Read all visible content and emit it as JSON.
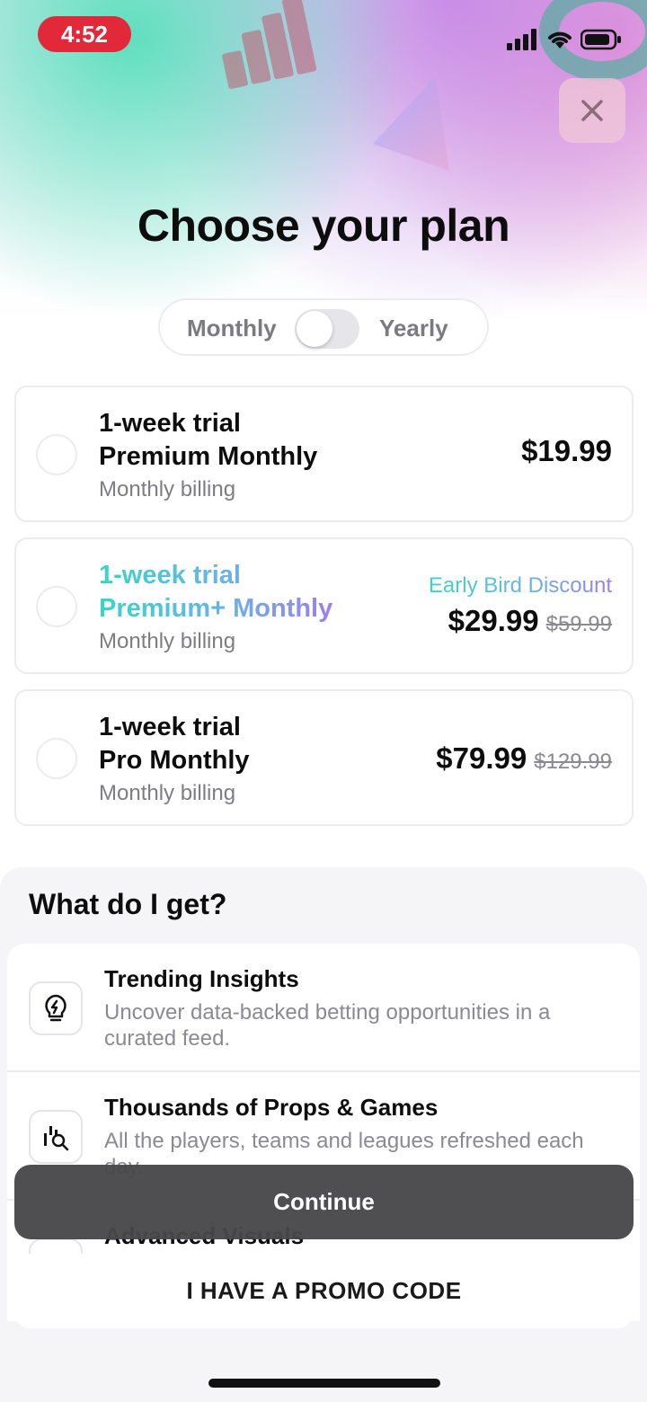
{
  "status_bar": {
    "time": "4:52",
    "icons": [
      "signal-icon",
      "wifi-icon",
      "battery-icon"
    ]
  },
  "header": {
    "title": "Choose your plan",
    "close_icon": "close-icon"
  },
  "billing_toggle": {
    "left_label": "Monthly",
    "right_label": "Yearly",
    "selected": "Monthly"
  },
  "plans": [
    {
      "line1": "1-week trial",
      "line2": "Premium Monthly",
      "billing": "Monthly billing",
      "price": "$19.99",
      "old_price": "",
      "badge": ""
    },
    {
      "line1": "1-week trial",
      "line2": "Premium+ Monthly",
      "billing": "Monthly billing",
      "price": "$29.99",
      "old_price": "$59.99",
      "badge": "Early Bird Discount"
    },
    {
      "line1": "1-week trial",
      "line2": "Pro Monthly",
      "billing": "Monthly billing",
      "price": "$79.99",
      "old_price": "$129.99",
      "badge": ""
    }
  ],
  "benefits": {
    "title": "What do I get?",
    "items": [
      {
        "icon": "lightbulb-icon",
        "title": "Trending Insights",
        "description": "Uncover data-backed betting opportunities in a curated feed."
      },
      {
        "icon": "chart-search-icon",
        "title": "Thousands of Props & Games",
        "description": "All the players, teams and leagues refreshed each day."
      },
      {
        "icon": "visuals-icon",
        "title": "Advanced Visuals",
        "description": ""
      }
    ]
  },
  "actions": {
    "continue_label": "Continue",
    "promo_label": "I HAVE A PROMO CODE"
  },
  "colors": {
    "accent_gradient": [
      "#38d6c5",
      "#9a7ef0"
    ],
    "time_pill": "#e2293a",
    "continue_bg": "#48484a"
  }
}
